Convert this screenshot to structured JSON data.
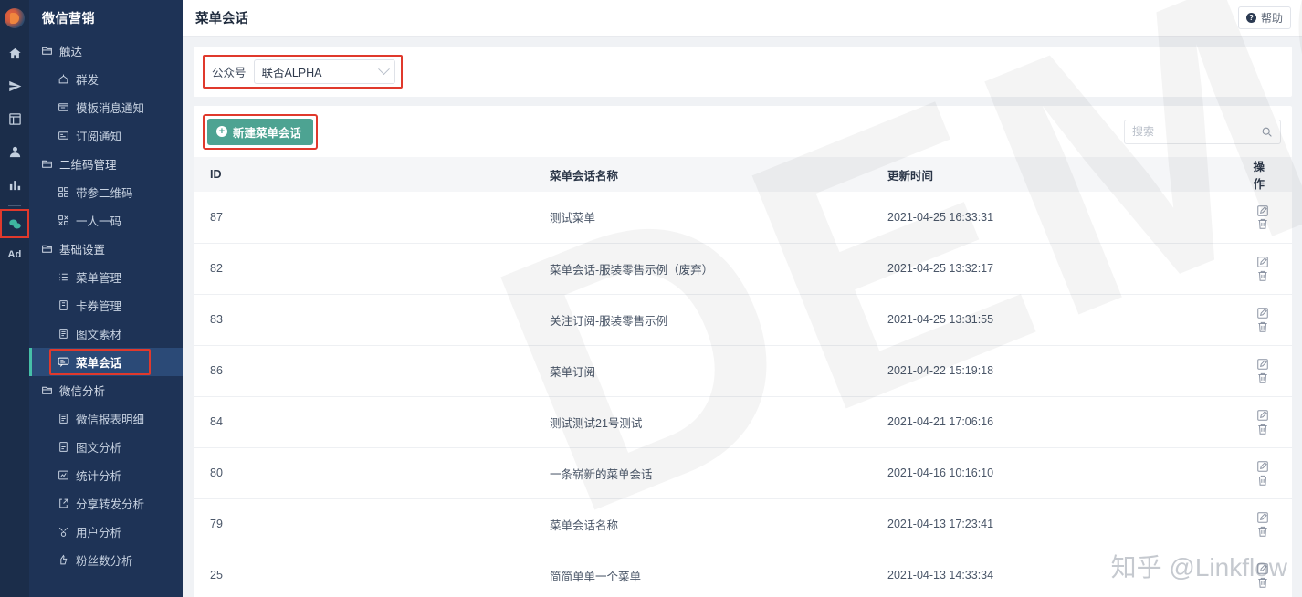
{
  "rail": {
    "logo_name": "app-logo",
    "items": [
      {
        "name": "home-icon",
        "label": "首页"
      },
      {
        "name": "send-icon",
        "label": "营销"
      },
      {
        "name": "dashboard-icon",
        "label": "看板"
      },
      {
        "name": "user-icon",
        "label": "客户"
      },
      {
        "name": "chart-icon",
        "label": "分析"
      },
      {
        "name": "wechat-icon",
        "label": "微信营销"
      }
    ],
    "ad_label": "Ad"
  },
  "sidebar": {
    "title": "微信营销",
    "groups": [
      {
        "label": "触达",
        "icon": "folder-icon",
        "items": [
          {
            "label": "群发",
            "icon": "broadcast-icon"
          },
          {
            "label": "模板消息通知",
            "icon": "template-icon"
          },
          {
            "label": "订阅通知",
            "icon": "subscribe-icon"
          }
        ]
      },
      {
        "label": "二维码管理",
        "icon": "folder-icon",
        "items": [
          {
            "label": "带参二维码",
            "icon": "qrcode-icon"
          },
          {
            "label": "一人一码",
            "icon": "personal-qrcode-icon"
          }
        ]
      },
      {
        "label": "基础设置",
        "icon": "folder-icon",
        "items": [
          {
            "label": "菜单管理",
            "icon": "list-icon"
          },
          {
            "label": "卡券管理",
            "icon": "coupon-icon"
          },
          {
            "label": "图文素材",
            "icon": "article-icon"
          },
          {
            "label": "菜单会话",
            "icon": "menu-chat-icon",
            "active": true,
            "highlighted": true
          }
        ]
      },
      {
        "label": "微信分析",
        "icon": "folder-icon",
        "items": [
          {
            "label": "微信报表明细",
            "icon": "report-icon"
          },
          {
            "label": "图文分析",
            "icon": "article-analysis-icon"
          },
          {
            "label": "统计分析",
            "icon": "stats-icon"
          },
          {
            "label": "分享转发分析",
            "icon": "share-icon"
          },
          {
            "label": "用户分析",
            "icon": "user-analysis-icon"
          },
          {
            "label": "粉丝数分析",
            "icon": "fans-icon"
          }
        ]
      }
    ]
  },
  "topbar": {
    "title": "菜单会话",
    "help_label": "帮助",
    "help_icon": "question-icon"
  },
  "filter": {
    "select_label": "公众号",
    "select_value": "联否ALPHA",
    "chevron_icon": "chevron-down-icon"
  },
  "toolbar": {
    "new_button_label": "新建菜单会话",
    "new_button_icon": "plus-circle-icon",
    "new_button_color": "#4da392",
    "search_placeholder": "搜索",
    "search_value": "",
    "search_icon": "search-icon"
  },
  "table": {
    "columns": [
      "ID",
      "菜单会话名称",
      "更新时间",
      "操作"
    ],
    "action_icons": [
      "edit-icon",
      "delete-icon"
    ],
    "rows": [
      {
        "id": "87",
        "name": "测试菜单",
        "updated": "2021-04-25 16:33:31"
      },
      {
        "id": "82",
        "name": "菜单会话-服装零售示例（废弃）",
        "updated": "2021-04-25 13:32:17"
      },
      {
        "id": "83",
        "name": "关注订阅-服装零售示例",
        "updated": "2021-04-25 13:31:55"
      },
      {
        "id": "86",
        "name": "菜单订阅",
        "updated": "2021-04-22 15:19:18"
      },
      {
        "id": "84",
        "name": "测试测试21号测试",
        "updated": "2021-04-21 17:06:16"
      },
      {
        "id": "80",
        "name": "一条崭新的菜单会话",
        "updated": "2021-04-16 10:16:10"
      },
      {
        "id": "79",
        "name": "菜单会话名称",
        "updated": "2021-04-13 17:23:41"
      },
      {
        "id": "25",
        "name": "简简单单一个菜单",
        "updated": "2021-04-13 14:33:34"
      }
    ]
  },
  "watermarks": {
    "demo": "DEMO",
    "zhihu": "知乎 @Linkflow"
  },
  "colors": {
    "accent_red": "#e0392c",
    "accent_green": "#4da392",
    "sidebar_bg": "#1e3356",
    "rail_bg": "#1b2d4a",
    "active_nav": "#2b4a77"
  }
}
